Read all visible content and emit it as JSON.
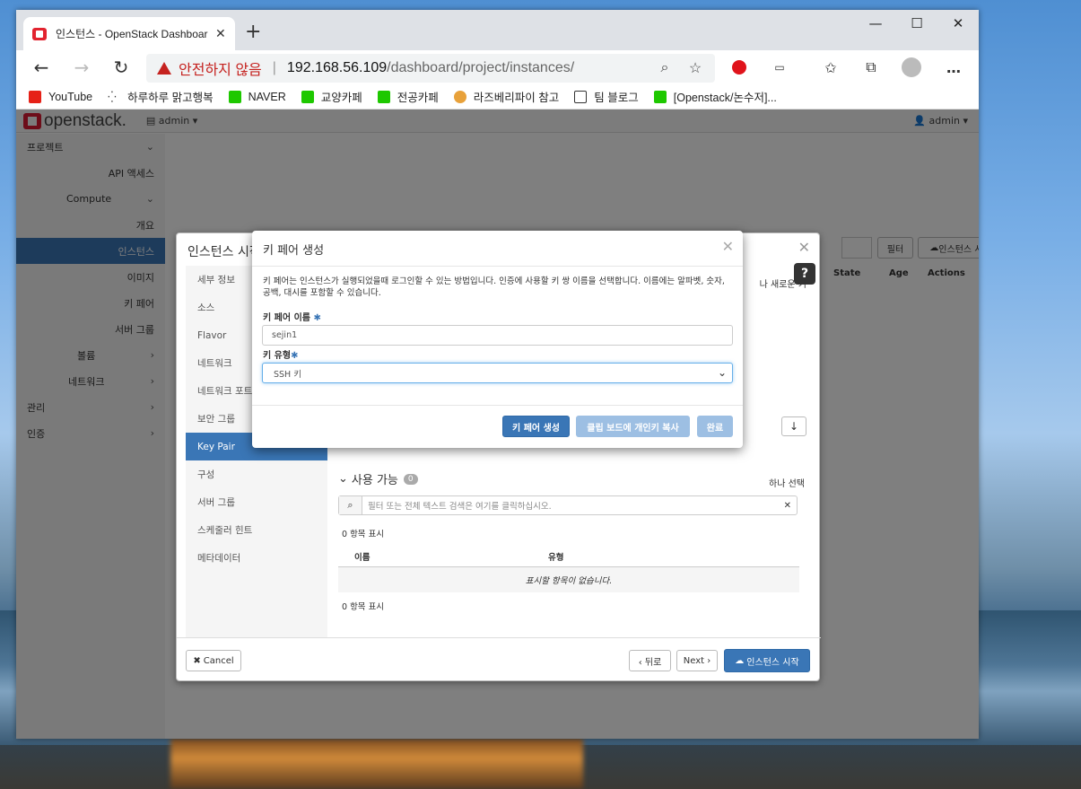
{
  "browser": {
    "tab_title": "인스턴스 - OpenStack Dashboard",
    "tab_close": "✕",
    "new_tab": "+",
    "security_warning": "안전하지 않음",
    "url_host": "192.168.56.109",
    "url_path": "/dashboard/project/instances/",
    "bookmarks": [
      {
        "label": "YouTube",
        "color": "#e62117"
      },
      {
        "label": "하루하루 맑고행복",
        "color": "#333333"
      },
      {
        "label": "NAVER",
        "color": "#1ec800"
      },
      {
        "label": "교양카페",
        "color": "#1ec800"
      },
      {
        "label": "전공카페",
        "color": "#1ec800"
      },
      {
        "label": "라즈베리파이 참고",
        "color": "#e8a13a"
      },
      {
        "label": "팀 블로그",
        "color": "#ffffff"
      },
      {
        "label": "[Openstack/논수저]...",
        "color": "#1ec800"
      }
    ]
  },
  "dashboard": {
    "brand": "openstack.",
    "project_dropdown": "admin ▾",
    "user_dropdown": "admin ▾",
    "sidebar": {
      "project": "프로젝트",
      "api_access": "API 액세스",
      "compute": "Compute",
      "overview": "개요",
      "instances": "인스턴스",
      "images": "이미지",
      "key_pairs": "키 페어",
      "server_groups": "서버 그룹",
      "volumes": "볼륨",
      "network": "네트워크",
      "admin": "관리",
      "identity": "인증"
    },
    "filter_button": "필터",
    "launch_button": "인스턴스 시작",
    "table_headers": [
      "State",
      "Age",
      "Actions"
    ],
    "side_hint": "나 새로운 키"
  },
  "wizard": {
    "title": "인스턴스 시작",
    "close": "✕",
    "help": "?",
    "nav": [
      "세부 정보",
      "소스",
      "Flavor",
      "네트워크",
      "네트워크 포트",
      "보안 그룹",
      "Key Pair",
      "구성",
      "서버 그룹",
      "스케줄러 힌트",
      "메타데이터"
    ],
    "available_label": "사용 가능",
    "available_count": "0",
    "select_one": "하나 선택",
    "filter_placeholder": "필터 또는 전체 텍스트 검색은 여기를 클릭하십시오.",
    "items_shown_top": "0 항목 표시",
    "col_name": "이름",
    "col_type": "유형",
    "empty_message": "표시할 항목이 없습니다.",
    "items_shown_bottom": "0 항목 표시",
    "cancel": "Cancel",
    "back": "‹ 뒤로",
    "next": "Next ›",
    "launch": "인스턴스 시작"
  },
  "modal": {
    "title": "키 페어 생성",
    "close": "✕",
    "description": "키 페어는 인스턴스가 실행되었을때 로그인할 수 있는 방법입니다. 인증에 사용할 키 쌍 이름을 선택합니다. 이름에는 알파벳, 숫자, 공백, 대시를 포함할 수 있습니다.",
    "name_label": "키 페어 이름",
    "name_value": "sejin1",
    "type_label": "키 유형",
    "type_value": "SSH 키",
    "required_mark": "✱",
    "create_button": "키 페어 생성",
    "copy_button": "클립 보드에 개인키 복사",
    "done_button": "완료"
  }
}
